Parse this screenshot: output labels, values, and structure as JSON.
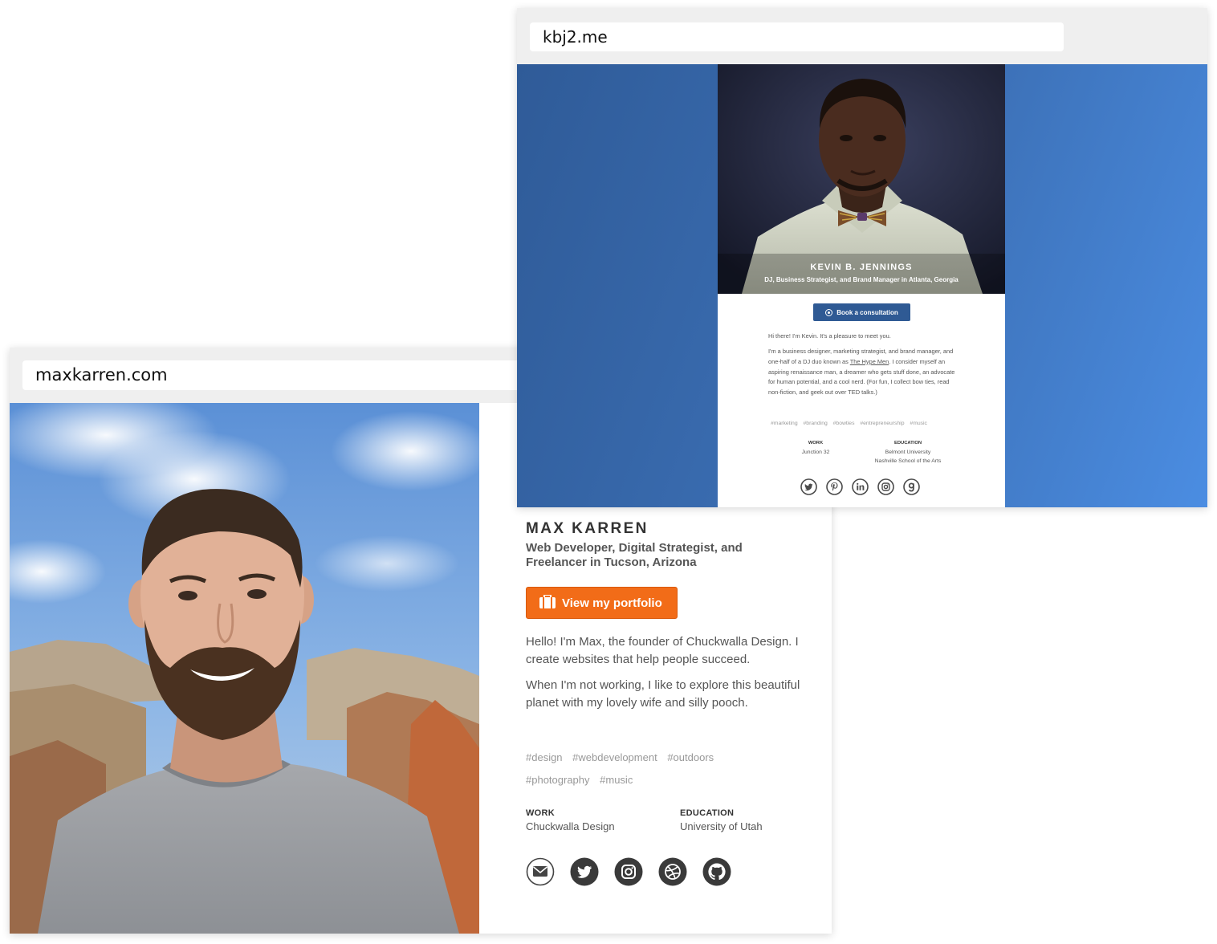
{
  "max_site": {
    "url": "maxkarren.com",
    "name": "MAX KARREN",
    "subtitle": "Web Developer, Digital Strategist, and Freelancer in Tucson, Arizona",
    "portfolio_button": "View my portfolio",
    "bio": [
      "Hello! I'm Max, the founder of Chuckwalla Design. I create websites that help people succeed.",
      "When I'm not working, I like to explore this beautiful planet with my lovely wife and silly pooch."
    ],
    "tags": [
      "#design",
      "#webdevelopment",
      "#outdoors",
      "#photography",
      "#music"
    ],
    "work": {
      "heading": "WORK",
      "value": "Chuckwalla Design"
    },
    "education": {
      "heading": "EDUCATION",
      "value": "University of Utah"
    },
    "social_icons": [
      "mail-icon",
      "twitter-icon",
      "instagram-icon",
      "dribbble-icon",
      "github-icon"
    ],
    "accent_color": "#f26c18"
  },
  "kevin_site": {
    "url": "kbj2.me",
    "name": "KEVIN B. JENNINGS",
    "subtitle": "DJ, Business Strategist, and Brand Manager in Atlanta, Georgia",
    "book_button": "Book a consultation",
    "greeting": "Hi there! I'm Kevin. It's a pleasure to meet you.",
    "bio_before_link": "I'm a business designer, marketing strategist, and brand manager, and one-half of a DJ duo known as ",
    "bio_link": "The Hype Men",
    "bio_after_link": ". I consider myself an aspiring renaissance man, a dreamer who gets stuff done, an advocate for human potential, and a cool nerd. (For fun, I collect bow ties, read non-fiction, and geek out over TED talks.)",
    "tags": [
      "#marketing",
      "#branding",
      "#bowties",
      "#entrepreneurship",
      "#music"
    ],
    "work": {
      "heading": "WORK",
      "value": "Junction 32"
    },
    "education": {
      "heading": "EDUCATION",
      "values": [
        "Belmont University",
        "Nashville School of the Arts"
      ]
    },
    "social_icons": [
      "twitter-icon",
      "pinterest-icon",
      "linkedin-icon",
      "instagram-icon",
      "goodreads-icon"
    ],
    "background_color": "#3c70b6",
    "button_color": "#2f5a94"
  }
}
